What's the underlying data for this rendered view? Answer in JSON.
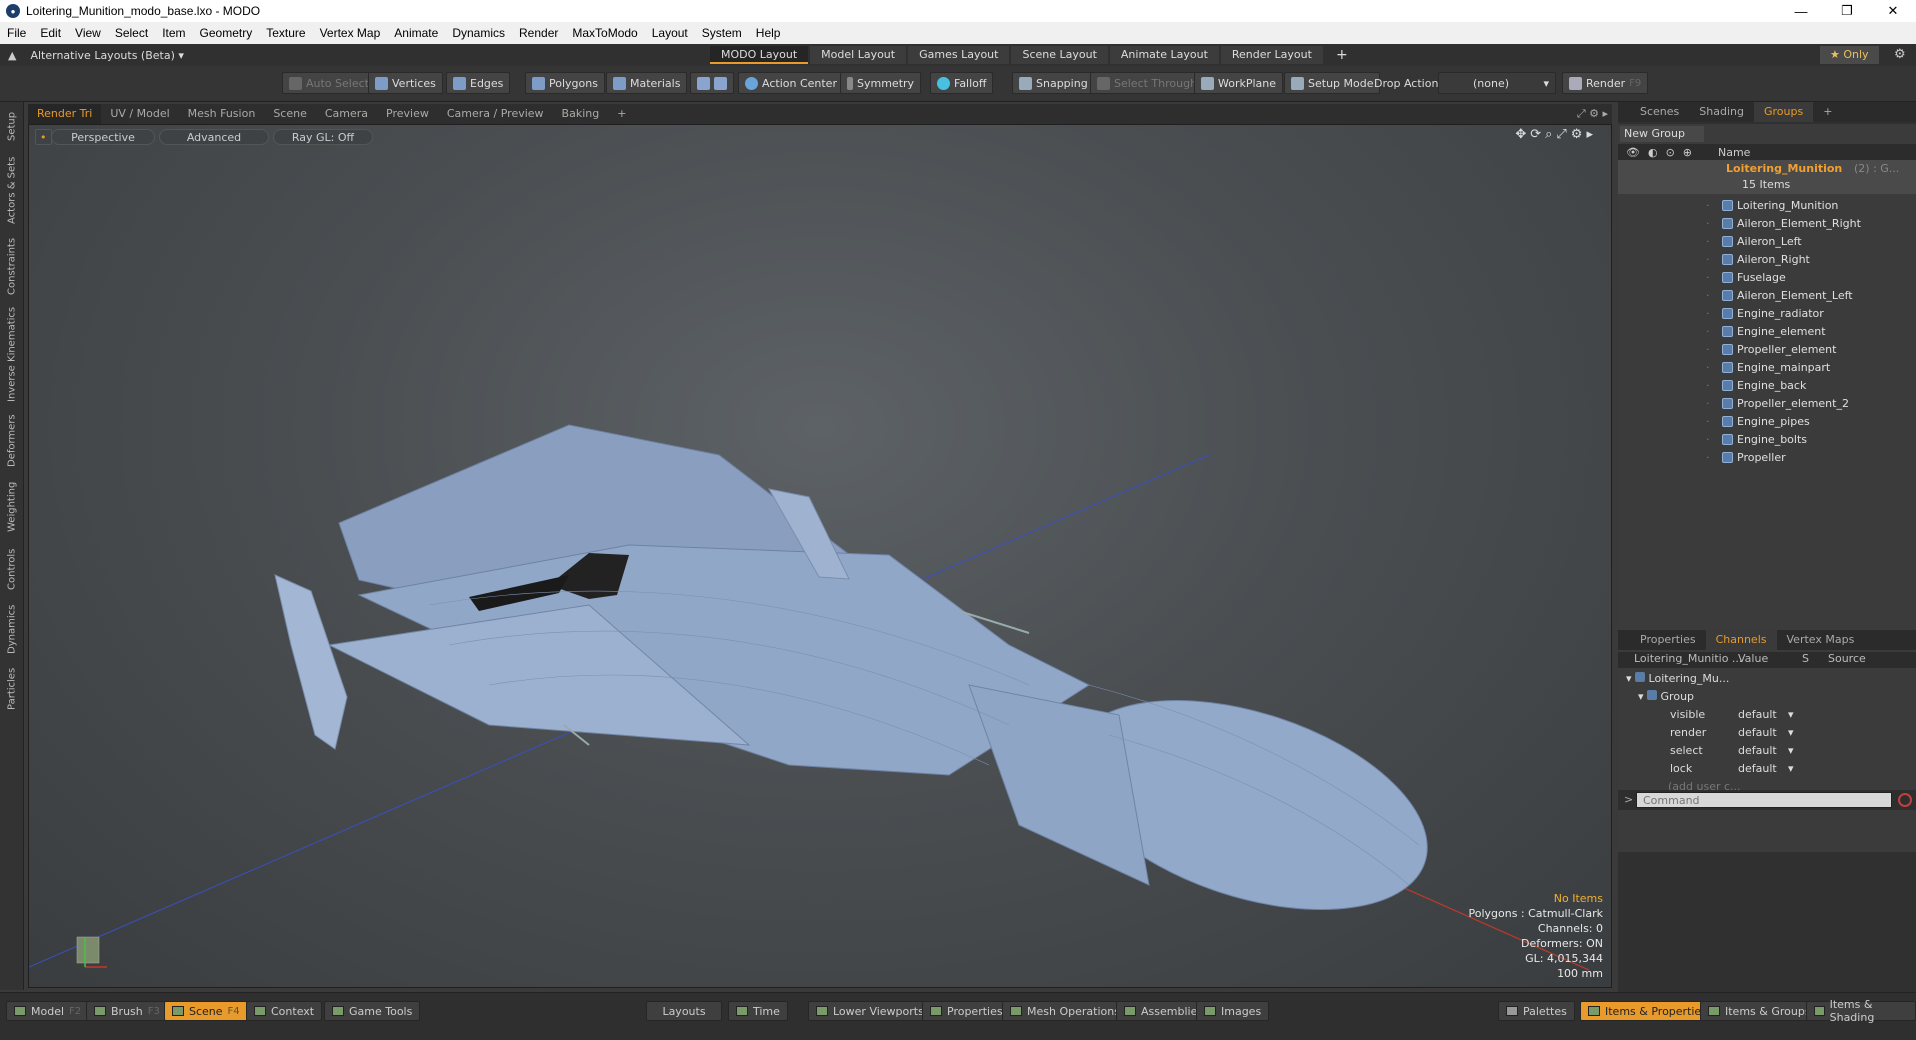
{
  "window": {
    "title": "Loitering_Munition_modo_base.lxo - MODO",
    "minimize": "—",
    "maximize": "❐",
    "close": "✕"
  },
  "menu": [
    "File",
    "Edit",
    "View",
    "Select",
    "Item",
    "Geometry",
    "Texture",
    "Vertex Map",
    "Animate",
    "Dynamics",
    "Render",
    "MaxToModo",
    "Layout",
    "System",
    "Help"
  ],
  "layoutbar": {
    "alt_layouts": "Alternative Layouts (Beta) ▾",
    "tabs": [
      "MODO Layout",
      "Model Layout",
      "Games Layout",
      "Scene Layout",
      "Animate Layout",
      "Render Layout"
    ],
    "add": "+",
    "only": "★  Only"
  },
  "toolbar": {
    "auto_select": "Auto Select",
    "vertices": "Vertices",
    "edges": "Edges",
    "polygons": "Polygons",
    "materials": "Materials",
    "action_center": "Action Center",
    "symmetry": "Symmetry",
    "falloff": "Falloff",
    "snapping": "Snapping",
    "select_through": "Select Through",
    "workplane": "WorkPlane",
    "setup_mode": "Setup Mode",
    "drop_action": "Drop Action",
    "drop_value": "(none)",
    "render": "Render",
    "render_key": "F9"
  },
  "left_tabs": [
    "Setup",
    "Actors & Sets",
    "Constraints",
    "Inverse Kinematics",
    "Deformers",
    "Weighting",
    "Controls",
    "Dynamics",
    "Particles"
  ],
  "viewport_tabs": [
    "Render Tri",
    "UV / Model",
    "Mesh Fusion",
    "Scene",
    "Camera",
    "Preview",
    "Camera / Preview",
    "Baking"
  ],
  "viewport": {
    "perspective": "Perspective",
    "advanced": "Advanced",
    "raygl": "Ray GL: Off",
    "info": {
      "items": "No Items",
      "polygons": "Polygons : Catmull-Clark",
      "channels": "Channels: 0",
      "deformers": "Deformers: ON",
      "gl": "GL: 4,015,344",
      "scale": "100 mm"
    }
  },
  "right_panel": {
    "top_tabs": [
      "Scenes",
      "Shading",
      "Groups"
    ],
    "new_group": "New Group",
    "name_header": "Name",
    "group_name": "Loitering_Munition",
    "group_suffix": "(2) : G...",
    "items_count": "15 Items",
    "items": [
      "Loitering_Munition",
      "Aileron_Element_Right",
      "Aileron_Left",
      "Aileron_Right",
      "Fuselage",
      "Aileron_Element_Left",
      "Engine_radiator",
      "Engine_element",
      "Propeller_element",
      "Engine_mainpart",
      "Engine_back",
      "Propeller_element_2",
      "Engine_pipes",
      "Engine_bolts",
      "Propeller"
    ],
    "bottom_tabs": [
      "Properties",
      "Channels",
      "Vertex Maps"
    ],
    "channels": {
      "col_name": "Loitering_Munitio ...",
      "col_value": "Value",
      "col_s": "S",
      "col_source": "Source",
      "root": "Loitering_Mu...",
      "group": "Group",
      "rows": [
        {
          "name": "visible",
          "value": "default"
        },
        {
          "name": "render",
          "value": "default"
        },
        {
          "name": "select",
          "value": "default"
        },
        {
          "name": "lock",
          "value": "default"
        }
      ],
      "add_user": "(add user c..."
    },
    "command_placeholder": "Command"
  },
  "bottombar": {
    "model": "Model",
    "model_key": "F2",
    "brush": "Brush",
    "brush_key": "F3",
    "scene": "Scene",
    "scene_key": "F4",
    "context": "Context",
    "game_tools": "Game Tools",
    "layouts": "Layouts",
    "time": "Time",
    "lower_viewports": "Lower Viewports",
    "properties": "Properties",
    "mesh_operations": "Mesh Operations",
    "assemblies": "Assemblies",
    "images": "Images",
    "palettes": "Palettes",
    "items_properties": "Items & Properties",
    "items_groups": "Items & Groups",
    "items_shading": "Items & Shading"
  },
  "colors": {
    "accent": "#e89a2a",
    "model": "#8fa6c8",
    "x_axis": "#c0392b",
    "z_axis": "#3a4fc0"
  }
}
